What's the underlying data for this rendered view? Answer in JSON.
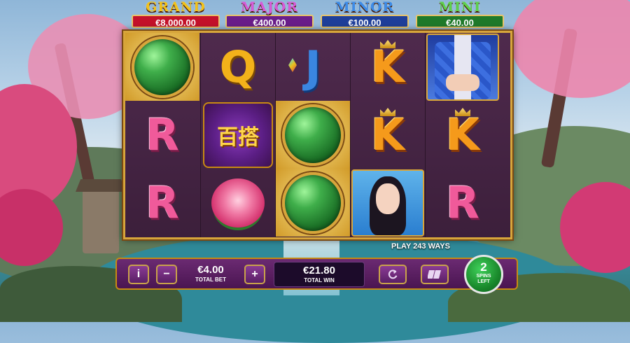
{
  "jackpots": [
    {
      "title": "GRAND",
      "value": "€8,000.00",
      "title_color": "#f2c21b",
      "box_color": "#c4122a"
    },
    {
      "title": "MAJOR",
      "value": "€400.00",
      "title_color": "#d65bd8",
      "box_color": "#6a1e8a"
    },
    {
      "title": "MINOR",
      "value": "€100.00",
      "title_color": "#3d8ce8",
      "box_color": "#1f3f9a"
    },
    {
      "title": "MINI",
      "value": "€40.00",
      "title_color": "#5ed14b",
      "box_color": "#1f7a2a"
    }
  ],
  "reels": {
    "col1": [
      "jade-gem",
      "R",
      "R"
    ],
    "col2": [
      "Q",
      "scatter",
      "peony"
    ],
    "col3": [
      "J",
      "jade-gem",
      "jade-gem"
    ],
    "col4": [
      "K",
      "K",
      "woman-portrait"
    ],
    "col5": [
      "robe-portrait",
      "K",
      "R"
    ]
  },
  "scatter_text": "百搭",
  "ways_text": "PLAY 243 WAYS",
  "controls": {
    "info_icon": "i",
    "minus_icon": "−",
    "plus_icon": "+",
    "total_bet_value": "€4.00",
    "total_bet_label": "TOTAL BET",
    "total_win_value": "€21.80",
    "total_win_label": "TOTAL WIN",
    "autoplay_icon": "refresh-icon",
    "turbo_icon": "turbo-icon",
    "spins_left_count": "2",
    "spins_left_label_1": "SPINS",
    "spins_left_label_2": "LEFT"
  }
}
